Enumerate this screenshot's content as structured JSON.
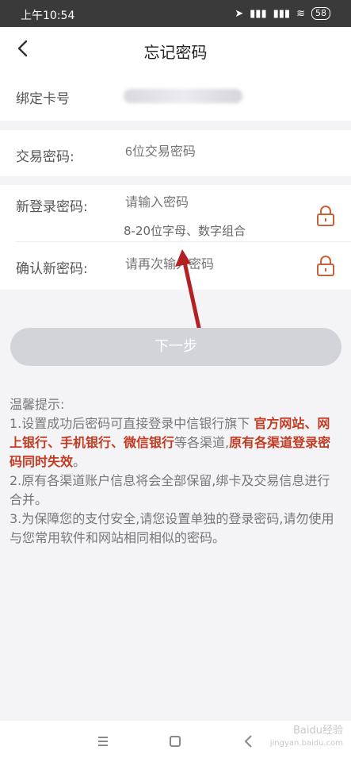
{
  "status_bar": {
    "time": "上午10:54",
    "battery": "58"
  },
  "nav": {
    "title": "忘记密码"
  },
  "form": {
    "card_label": "绑定卡号",
    "trade_pwd_label": "交易密码:",
    "trade_pwd_placeholder": "6位交易密码",
    "new_pwd_label": "新登录密码:",
    "new_pwd_placeholder": "请输入密码",
    "new_pwd_hint": "8-20位字母、数字组合",
    "confirm_pwd_label": "确认新密码:",
    "confirm_pwd_placeholder": "请再次输入密码"
  },
  "next_button": "下一步",
  "tips": {
    "title": "温馨提示:",
    "t1_a": "1.设置成功后密码可直接登录中信银行旗下 ",
    "t1_b": "官方网站、网上银行、手机银行、微信银行",
    "t1_c": "等各渠道,",
    "t1_d": "原有各渠道登录密码同时失效",
    "t1_e": "。",
    "t2": "2.原有各渠道账户信息将会全部保留,绑卡及交易信息进行合并。",
    "t3": "3.为保障您的支付安全,请您设置单独的登录密码,请勿使用与您常用软件和网站相同相似的密码。"
  },
  "watermark": {
    "line1": "Baidu经验",
    "line2": "jingyan.baidu.com"
  },
  "colors": {
    "accent": "#c23b22",
    "lock": "#c9603c",
    "arrow": "#b22222"
  }
}
